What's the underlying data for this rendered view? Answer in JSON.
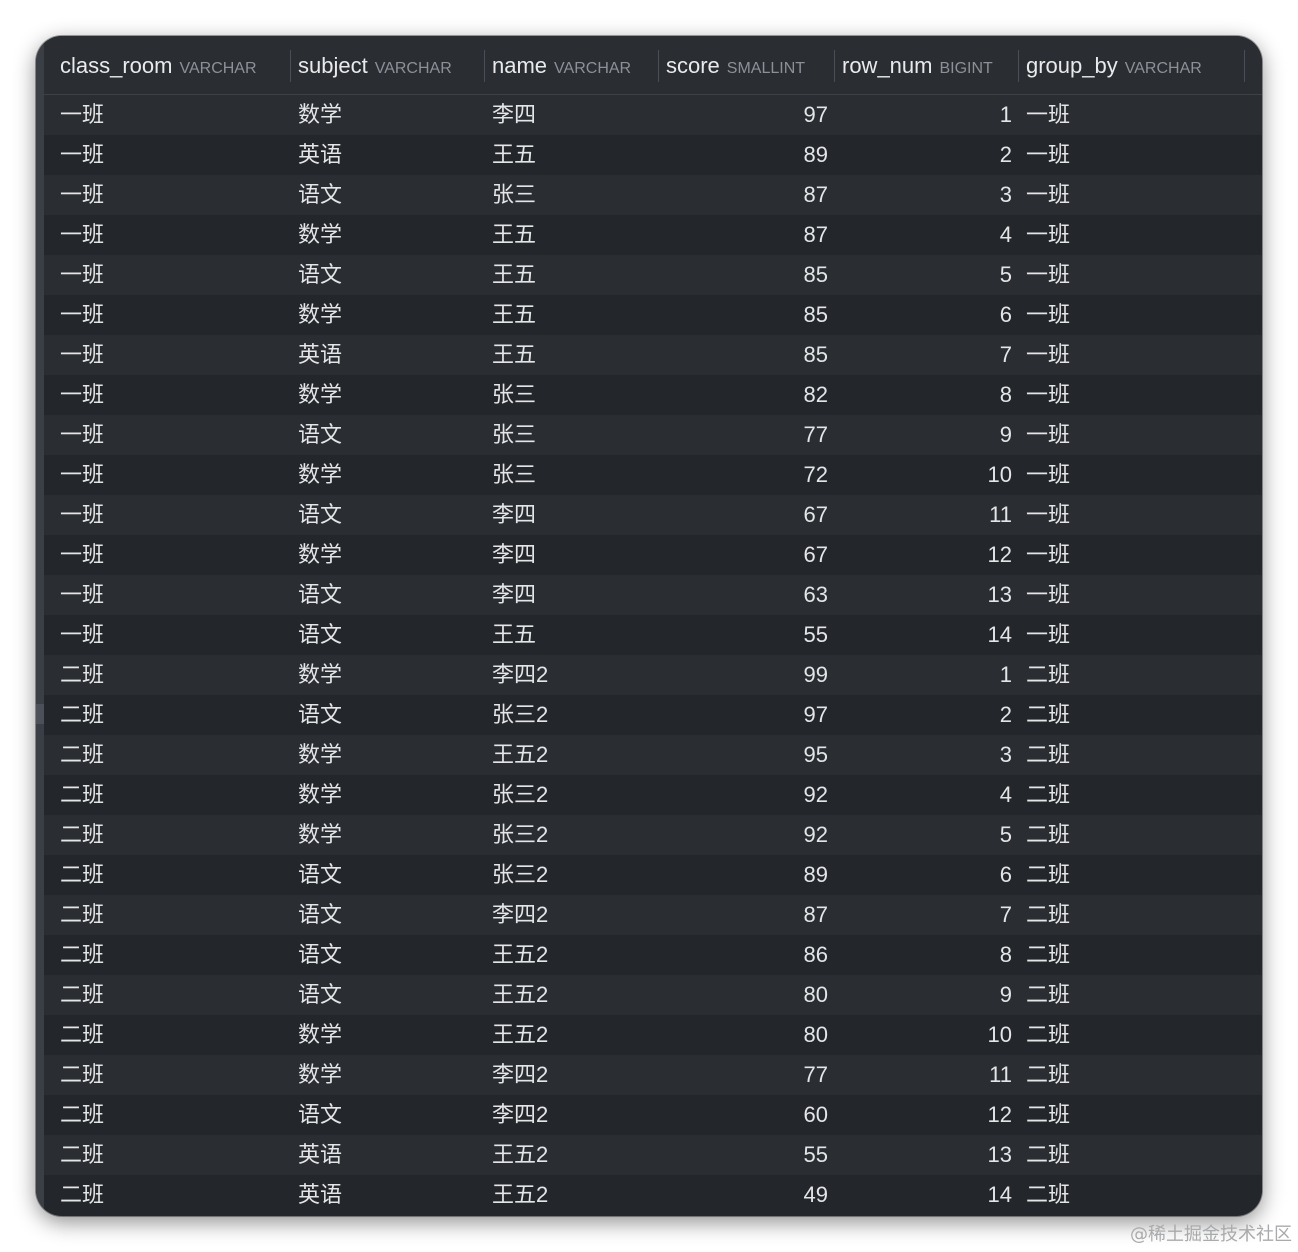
{
  "columns": [
    {
      "name": "class_room",
      "type": "VARCHAR"
    },
    {
      "name": "subject",
      "type": "VARCHAR"
    },
    {
      "name": "name",
      "type": "VARCHAR"
    },
    {
      "name": "score",
      "type": "SMALLINT"
    },
    {
      "name": "row_num",
      "type": "BIGINT"
    },
    {
      "name": "group_by",
      "type": "VARCHAR"
    }
  ],
  "rows": [
    [
      "一班",
      "数学",
      "李四",
      "97",
      "1",
      "一班"
    ],
    [
      "一班",
      "英语",
      "王五",
      "89",
      "2",
      "一班"
    ],
    [
      "一班",
      "语文",
      "张三",
      "87",
      "3",
      "一班"
    ],
    [
      "一班",
      "数学",
      "王五",
      "87",
      "4",
      "一班"
    ],
    [
      "一班",
      "语文",
      "王五",
      "85",
      "5",
      "一班"
    ],
    [
      "一班",
      "数学",
      "王五",
      "85",
      "6",
      "一班"
    ],
    [
      "一班",
      "英语",
      "王五",
      "85",
      "7",
      "一班"
    ],
    [
      "一班",
      "数学",
      "张三",
      "82",
      "8",
      "一班"
    ],
    [
      "一班",
      "语文",
      "张三",
      "77",
      "9",
      "一班"
    ],
    [
      "一班",
      "数学",
      "张三",
      "72",
      "10",
      "一班"
    ],
    [
      "一班",
      "语文",
      "李四",
      "67",
      "11",
      "一班"
    ],
    [
      "一班",
      "数学",
      "李四",
      "67",
      "12",
      "一班"
    ],
    [
      "一班",
      "语文",
      "李四",
      "63",
      "13",
      "一班"
    ],
    [
      "一班",
      "语文",
      "王五",
      "55",
      "14",
      "一班"
    ],
    [
      "二班",
      "数学",
      "李四2",
      "99",
      "1",
      "二班"
    ],
    [
      "二班",
      "语文",
      "张三2",
      "97",
      "2",
      "二班"
    ],
    [
      "二班",
      "数学",
      "王五2",
      "95",
      "3",
      "二班"
    ],
    [
      "二班",
      "数学",
      "张三2",
      "92",
      "4",
      "二班"
    ],
    [
      "二班",
      "数学",
      "张三2",
      "92",
      "5",
      "二班"
    ],
    [
      "二班",
      "语文",
      "张三2",
      "89",
      "6",
      "二班"
    ],
    [
      "二班",
      "语文",
      "李四2",
      "87",
      "7",
      "二班"
    ],
    [
      "二班",
      "语文",
      "王五2",
      "86",
      "8",
      "二班"
    ],
    [
      "二班",
      "语文",
      "王五2",
      "80",
      "9",
      "二班"
    ],
    [
      "二班",
      "数学",
      "王五2",
      "80",
      "10",
      "二班"
    ],
    [
      "二班",
      "数学",
      "李四2",
      "77",
      "11",
      "二班"
    ],
    [
      "二班",
      "语文",
      "李四2",
      "60",
      "12",
      "二班"
    ],
    [
      "二班",
      "英语",
      "王五2",
      "55",
      "13",
      "二班"
    ],
    [
      "二班",
      "英语",
      "王五2",
      "49",
      "14",
      "二班"
    ]
  ],
  "watermark": "@稀土掘金技术社区"
}
